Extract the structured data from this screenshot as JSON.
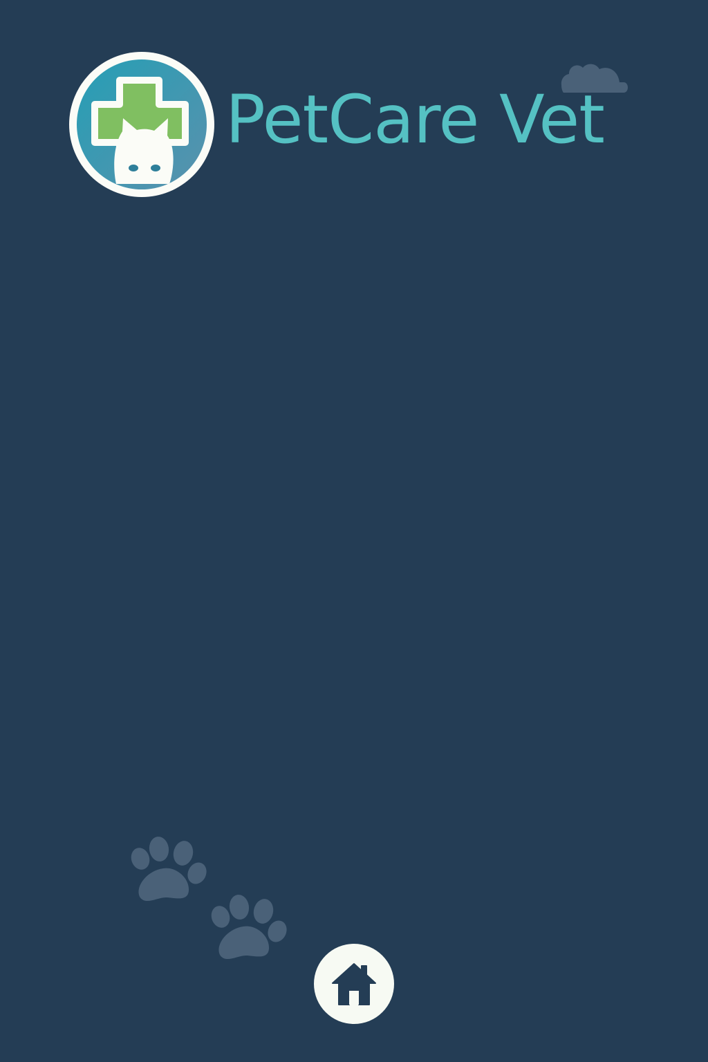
{
  "app": {
    "name": "PetCare Vet"
  },
  "icons": {
    "logo": "vet-cross-cat-logo-icon",
    "cloud": "cloud-icon",
    "paws": [
      "paw-print-icon",
      "paw-print-icon"
    ],
    "home": "home-icon"
  },
  "colors": {
    "background": "#243d55",
    "brand_teal": "#55c1c3",
    "logo_green": "#80bf61",
    "logo_blue": "#2f93a8",
    "decor_gray": "#4a6178",
    "white": "#fbfcf7"
  }
}
